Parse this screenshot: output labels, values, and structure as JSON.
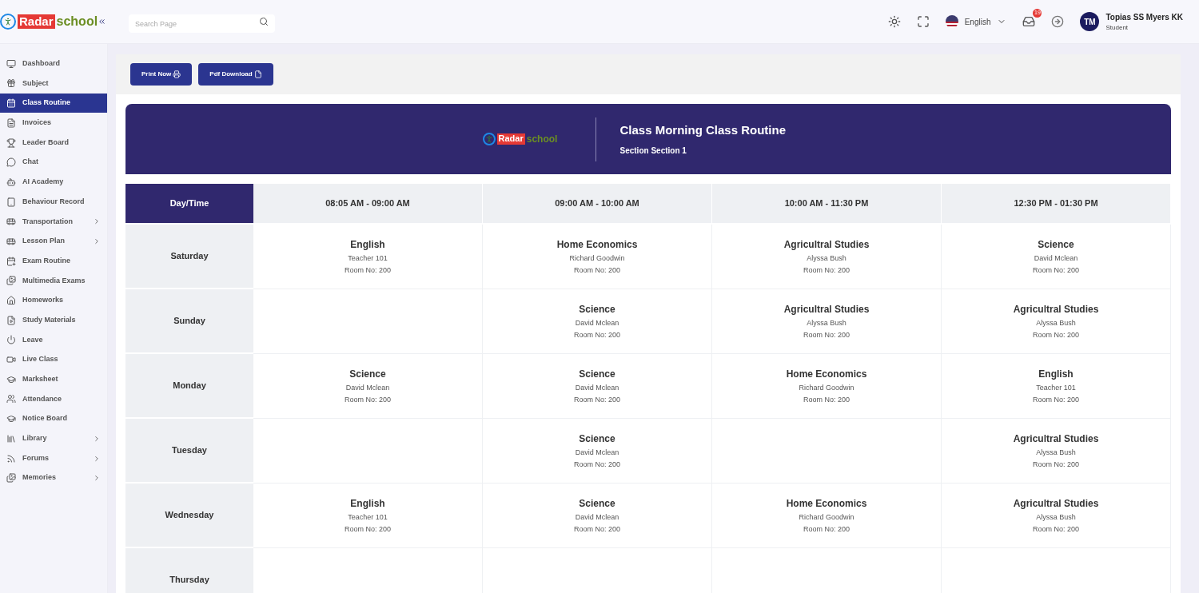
{
  "brand": {
    "part_1": "Radar",
    "part_2": "school"
  },
  "search": {
    "placeholder": "Search Page"
  },
  "language": {
    "label": "English"
  },
  "notifications": {
    "count": "19"
  },
  "user": {
    "initials": "TM",
    "name": "Topias SS Myers KK",
    "role": "Student"
  },
  "sidebar": {
    "items": [
      {
        "label": "Dashboard",
        "selected": false,
        "expandable": false
      },
      {
        "label": "Subject",
        "selected": false,
        "expandable": false
      },
      {
        "label": "Class Routine",
        "selected": true,
        "expandable": false
      },
      {
        "label": "Invoices",
        "selected": false,
        "expandable": false
      },
      {
        "label": "Leader Board",
        "selected": false,
        "expandable": false
      },
      {
        "label": "Chat",
        "selected": false,
        "expandable": false
      },
      {
        "label": "AI Academy",
        "selected": false,
        "expandable": false
      },
      {
        "label": "Behaviour Record",
        "selected": false,
        "expandable": false
      },
      {
        "label": "Transportation",
        "selected": false,
        "expandable": true
      },
      {
        "label": "Lesson Plan",
        "selected": false,
        "expandable": true
      },
      {
        "label": "Exam Routine",
        "selected": false,
        "expandable": false
      },
      {
        "label": "Multimedia Exams",
        "selected": false,
        "expandable": false
      },
      {
        "label": "Homeworks",
        "selected": false,
        "expandable": false
      },
      {
        "label": "Study Materials",
        "selected": false,
        "expandable": false
      },
      {
        "label": "Leave",
        "selected": false,
        "expandable": false
      },
      {
        "label": "Live Class",
        "selected": false,
        "expandable": false
      },
      {
        "label": "Marksheet",
        "selected": false,
        "expandable": false
      },
      {
        "label": "Attendance",
        "selected": false,
        "expandable": false
      },
      {
        "label": "Notice Board",
        "selected": false,
        "expandable": false
      },
      {
        "label": "Library",
        "selected": false,
        "expandable": true
      },
      {
        "label": "Forums",
        "selected": false,
        "expandable": true
      },
      {
        "label": "Memories",
        "selected": false,
        "expandable": true
      }
    ]
  },
  "actions": [
    {
      "label": "Print Now"
    },
    {
      "label": "Pdf Download"
    }
  ],
  "routine": {
    "brand": {
      "part_1": "Radar",
      "part_2": "school"
    },
    "title": "Class Morning Class Routine",
    "subtitle": "Section Section 1",
    "corner_header": "Day/Time",
    "columns": [
      "08:05 AM - 09:00 AM",
      "09:00 AM - 10:00 AM",
      "10:00 AM - 11:30 PM",
      "12:30 PM - 01:30 PM"
    ],
    "rows": [
      {
        "day": "Saturday",
        "cells": [
          {
            "subject": "English",
            "teacher": "Teacher 101",
            "room": "Room No: 200"
          },
          {
            "subject": "Home Economics",
            "teacher": "Richard Goodwin",
            "room": "Room No: 200"
          },
          {
            "subject": "Agricultral Studies",
            "teacher": "Alyssa Bush",
            "room": "Room No: 200"
          },
          {
            "subject": "Science",
            "teacher": "David Mclean",
            "room": "Room No: 200"
          }
        ]
      },
      {
        "day": "Sunday",
        "cells": [
          null,
          {
            "subject": "Science",
            "teacher": "David Mclean",
            "room": "Room No: 200"
          },
          {
            "subject": "Agricultral Studies",
            "teacher": "Alyssa Bush",
            "room": "Room No: 200"
          },
          {
            "subject": "Agricultral Studies",
            "teacher": "Alyssa Bush",
            "room": "Room No: 200"
          }
        ]
      },
      {
        "day": "Monday",
        "cells": [
          {
            "subject": "Science",
            "teacher": "David Mclean",
            "room": "Room No: 200"
          },
          {
            "subject": "Science",
            "teacher": "David Mclean",
            "room": "Room No: 200"
          },
          {
            "subject": "Home Economics",
            "teacher": "Richard Goodwin",
            "room": "Room No: 200"
          },
          {
            "subject": "English",
            "teacher": "Teacher 101",
            "room": "Room No: 200"
          }
        ]
      },
      {
        "day": "Tuesday",
        "cells": [
          null,
          {
            "subject": "Science",
            "teacher": "David Mclean",
            "room": "Room No: 200"
          },
          null,
          {
            "subject": "Agricultral Studies",
            "teacher": "Alyssa Bush",
            "room": "Room No: 200"
          }
        ]
      },
      {
        "day": "Wednesday",
        "cells": [
          {
            "subject": "English",
            "teacher": "Teacher 101",
            "room": "Room No: 200"
          },
          {
            "subject": "Science",
            "teacher": "David Mclean",
            "room": "Room No: 200"
          },
          {
            "subject": "Home Economics",
            "teacher": "Richard Goodwin",
            "room": "Room No: 200"
          },
          {
            "subject": "Agricultral Studies",
            "teacher": "Alyssa Bush",
            "room": "Room No: 200"
          }
        ]
      },
      {
        "day": "Thursday",
        "cells": [
          null,
          null,
          null,
          null
        ]
      }
    ]
  }
}
